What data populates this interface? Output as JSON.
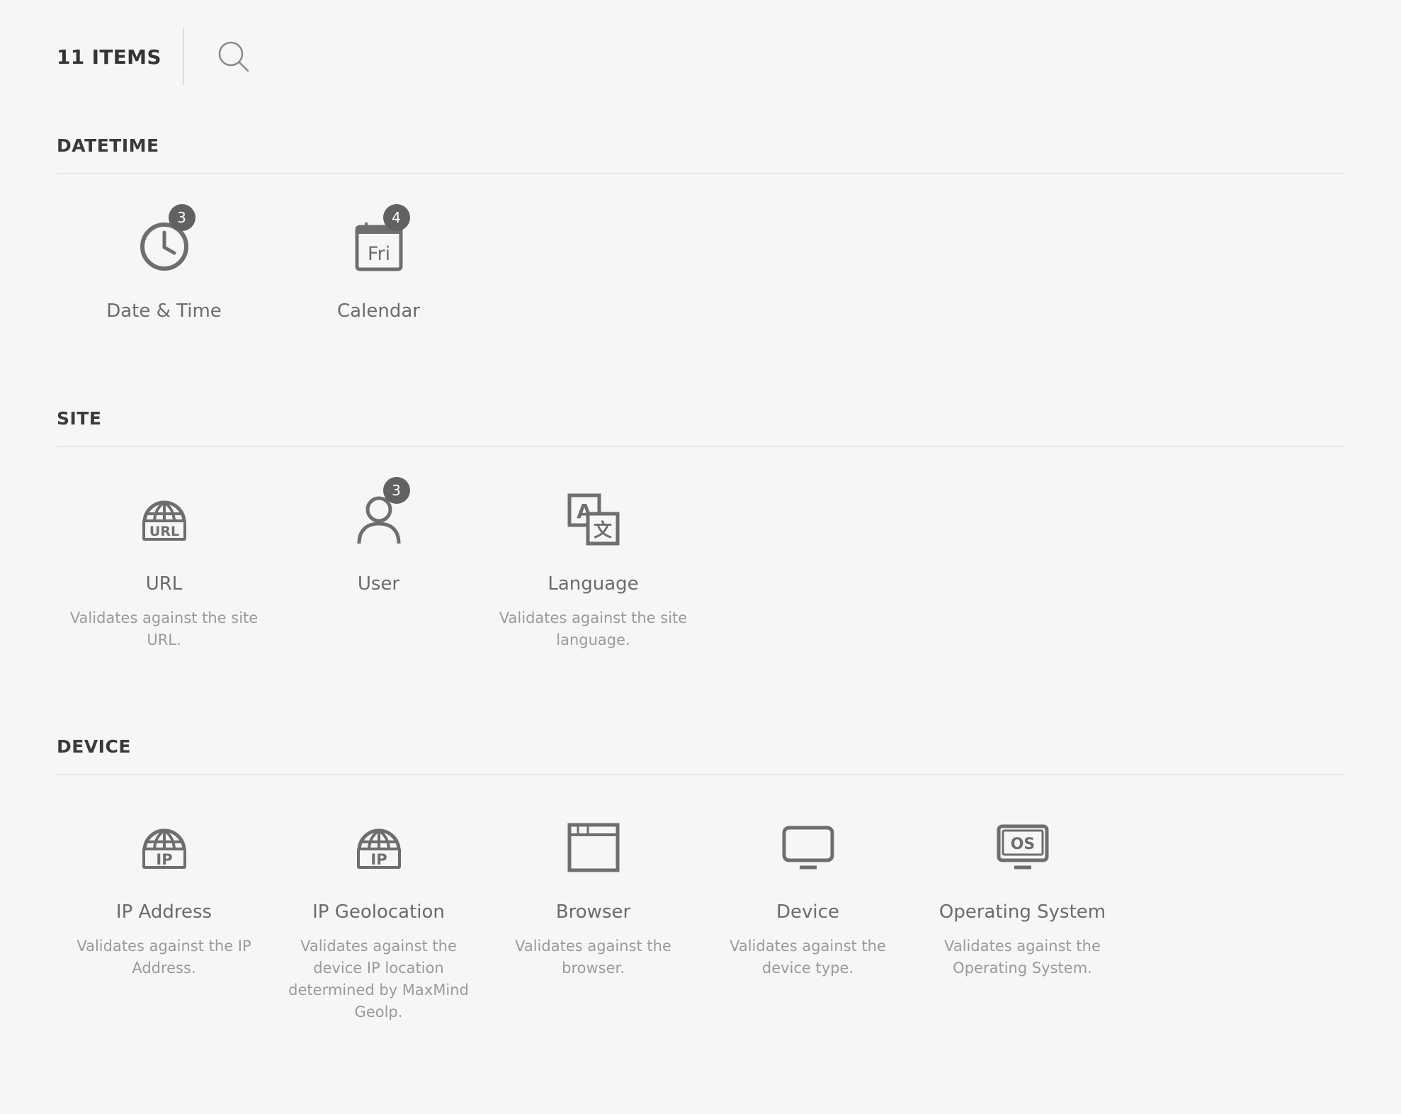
{
  "header": {
    "items_count": "11 ITEMS",
    "search_icon": "search-icon"
  },
  "sections": [
    {
      "title": "DATETIME",
      "items": [
        {
          "label": "Date & Time",
          "badge": "3",
          "icon": "clock-icon",
          "description": ""
        },
        {
          "label": "Calendar",
          "badge": "4",
          "icon": "calendar-icon",
          "icon_text": "Fri",
          "description": ""
        }
      ]
    },
    {
      "title": "SITE",
      "items": [
        {
          "label": "URL",
          "icon": "url-globe-icon",
          "icon_text": "URL",
          "description": "Validates against the site URL."
        },
        {
          "label": "User",
          "badge": "3",
          "icon": "user-icon",
          "description": ""
        },
        {
          "label": "Language",
          "icon": "language-icon",
          "icon_text_a": "A",
          "icon_text_b": "文",
          "description": "Validates against the site language."
        }
      ]
    },
    {
      "title": "DEVICE",
      "items": [
        {
          "label": "IP Address",
          "icon": "ip-globe-icon",
          "icon_text": "IP",
          "description": "Validates against the IP Address."
        },
        {
          "label": "IP Geolocation",
          "icon": "ip-geolocation-icon",
          "icon_text": "IP",
          "description": "Validates against the device IP location determined by MaxMind Geolp."
        },
        {
          "label": "Browser",
          "icon": "browser-window-icon",
          "description": "Validates against the browser."
        },
        {
          "label": "Device",
          "icon": "monitor-icon",
          "description": "Validates against the device type."
        },
        {
          "label": "Operating System",
          "icon": "os-monitor-icon",
          "icon_text": "OS",
          "description": "Validates against the Operating System."
        }
      ]
    }
  ],
  "colors": {
    "background": "#f6f6f6",
    "icon": "#6e6e6e",
    "badge": "#616161",
    "heading": "#3a3a3a",
    "label": "#6b6b6b",
    "description": "#9a9a9a"
  }
}
